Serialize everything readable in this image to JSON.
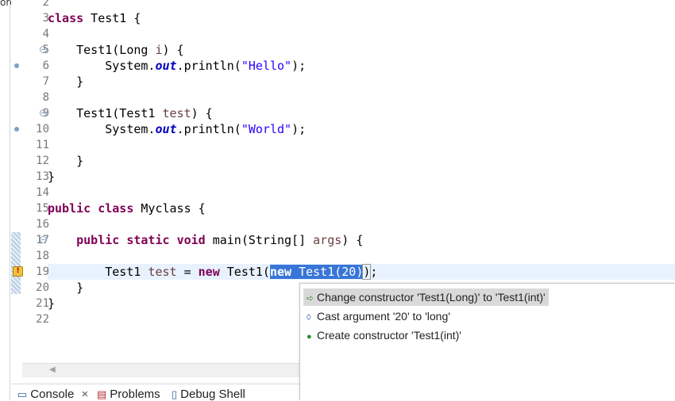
{
  "left_frame_text": "org",
  "editor": {
    "lines": [
      {
        "n": "2",
        "fold": false,
        "marker": false
      },
      {
        "n": "3",
        "fold": false,
        "marker": false
      },
      {
        "n": "4",
        "fold": false,
        "marker": false
      },
      {
        "n": "5",
        "fold": true,
        "marker": false
      },
      {
        "n": "6",
        "fold": false,
        "marker": true
      },
      {
        "n": "7",
        "fold": false,
        "marker": false
      },
      {
        "n": "8",
        "fold": false,
        "marker": false
      },
      {
        "n": "9",
        "fold": true,
        "marker": false
      },
      {
        "n": "10",
        "fold": false,
        "marker": true
      },
      {
        "n": "11",
        "fold": false,
        "marker": false
      },
      {
        "n": "12",
        "fold": false,
        "marker": false
      },
      {
        "n": "13",
        "fold": false,
        "marker": false
      },
      {
        "n": "14",
        "fold": false,
        "marker": false
      },
      {
        "n": "15",
        "fold": false,
        "marker": false
      },
      {
        "n": "16",
        "fold": false,
        "marker": false
      },
      {
        "n": "17",
        "fold": true,
        "marker": false
      },
      {
        "n": "18",
        "fold": false,
        "marker": false
      },
      {
        "n": "19",
        "fold": false,
        "marker": false
      },
      {
        "n": "20",
        "fold": false,
        "marker": false
      },
      {
        "n": "21",
        "fold": false,
        "marker": false
      },
      {
        "n": "22",
        "fold": false,
        "marker": false
      }
    ],
    "code": {
      "l3_kw": "class",
      "l3_rest": " Test1 {",
      "l5_a": "Test1(Long ",
      "l5_param": "i",
      "l5_b": ") {",
      "l6_a": "System.",
      "l6_field": "out",
      "l6_b": ".println(",
      "l6_str": "\"Hello\"",
      "l6_c": ");",
      "l7": "}",
      "l9_a": "Test1(Test1 ",
      "l9_param": "test",
      "l9_b": ") {",
      "l10_a": "System.",
      "l10_field": "out",
      "l10_b": ".println(",
      "l10_str": "\"World\"",
      "l10_c": ");",
      "l12": "}",
      "l13": "}",
      "l15_kw1": "public",
      "l15_kw2": "class",
      "l15_rest": " Myclass {",
      "l17_kw1": "public",
      "l17_kw2": "static",
      "l17_kw3": "void",
      "l17_a": " main(String[] ",
      "l17_param": "args",
      "l17_b": ") {",
      "l19_a": "Test1 ",
      "l19_var": "test",
      "l19_b": " = ",
      "l19_kw": "new",
      "l19_c": " Test1(",
      "l19_sel_kw": "new",
      "l19_sel_rest": " Test1(20)",
      "l19_bracket": ")",
      "l19_d": ";",
      "l20": "}",
      "l21": "}"
    }
  },
  "quick_fix": {
    "items": [
      {
        "icon": "change-icon",
        "label": "Change constructor 'Test1(Long)' to 'Test1(int)'",
        "selected": true
      },
      {
        "icon": "cast-icon",
        "label": "Cast argument '20' to 'long'",
        "selected": false
      },
      {
        "icon": "create-constructor-icon",
        "label": "Create constructor 'Test1(int)'",
        "selected": false
      }
    ]
  },
  "bottom_tabs": {
    "console": "Console",
    "console_close": "×",
    "problems": "Problems",
    "debug_shell": "Debug Shell"
  },
  "colors": {
    "keyword": "#7f0055",
    "string": "#2a00ff",
    "field": "#0000c0",
    "param": "#6a3e3e",
    "selection": "#3875d7",
    "current_line": "#e8f2fe"
  }
}
